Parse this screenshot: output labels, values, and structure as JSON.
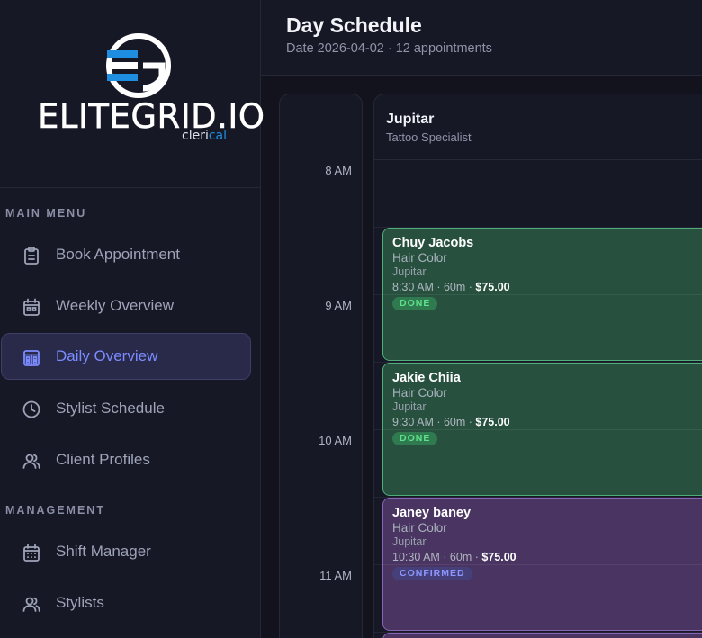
{
  "brand": {
    "wordmark": "ELITEGRID.IO",
    "sub_prefix": "cleri",
    "sub_accent": "cal",
    "colors": {
      "blue": "#1e8fe0",
      "white": "#ffffff"
    }
  },
  "sidebar": {
    "sections": [
      {
        "label": "MAIN MENU"
      },
      {
        "label": "MANAGEMENT"
      }
    ],
    "items": [
      {
        "label": "Book Appointment",
        "icon": "clipboard-icon",
        "active": false
      },
      {
        "label": "Weekly Overview",
        "icon": "calendar-week-icon",
        "active": false
      },
      {
        "label": "Daily Overview",
        "icon": "calendar-day-icon",
        "active": true
      },
      {
        "label": "Stylist Schedule",
        "icon": "clock-icon",
        "active": false
      },
      {
        "label": "Client Profiles",
        "icon": "users-icon",
        "active": false
      },
      {
        "label": "Shift Manager",
        "icon": "calendar-grid-icon",
        "active": false
      },
      {
        "label": "Stylists",
        "icon": "users-icon",
        "active": false
      }
    ]
  },
  "header": {
    "title": "Day Schedule",
    "subtitle": "Date 2026-04-02 · 12 appointments"
  },
  "schedule": {
    "times": [
      "8 AM",
      "9 AM",
      "10 AM",
      "11 AM"
    ],
    "stylist": {
      "name": "Jupitar",
      "role": "Tattoo Specialist"
    },
    "appointments": [
      {
        "client": "Chuy Jacobs",
        "service": "Hair Color",
        "stylist": "Jupitar",
        "meta": "8:30 AM · 60m · ",
        "price": "$75.00",
        "status": "DONE"
      },
      {
        "client": "Jakie Chiia",
        "service": "Hair Color",
        "stylist": "Jupitar",
        "meta": "9:30 AM · 60m · ",
        "price": "$75.00",
        "status": "DONE"
      },
      {
        "client": "Janey baney",
        "service": "Hair Color",
        "stylist": "Jupitar",
        "meta": "10:30 AM · 60m · ",
        "price": "$75.00",
        "status": "CONFIRMED"
      }
    ],
    "status_colors": {
      "done": "#27503f",
      "confirmed": "#4a3461"
    }
  }
}
